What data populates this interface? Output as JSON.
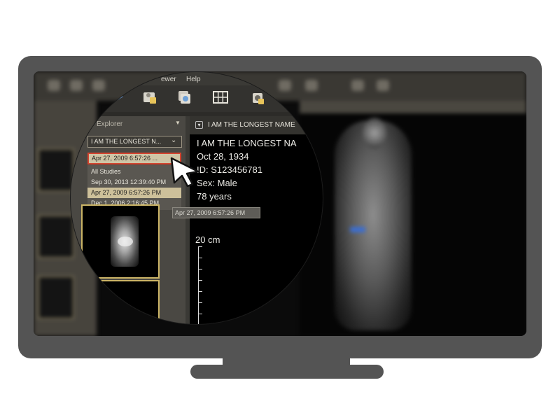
{
  "menu": {
    "viewer_partial": "ewer",
    "help": "Help"
  },
  "explorer": {
    "title_partial": "Explorer",
    "patient": "I AM THE LONGEST N...",
    "study_selected": "Apr 27, 2009 6:57:26 ...",
    "studies": [
      {
        "label": "All Studies"
      },
      {
        "label": "Sep 30, 2013 12:39:40 PM"
      },
      {
        "label": "Apr 27, 2009 6:57:26 PM"
      },
      {
        "label": "Dec 1, 2006 2:16:45 PM"
      }
    ]
  },
  "tooltip": "Apr 27, 2009 6:57:26 PM",
  "viewer": {
    "title": "I AM THE LONGEST NAME",
    "overlay": {
      "name": "I AM THE LONGEST NA",
      "dob": "Oct 28, 1934",
      "id": "ID: S123456781",
      "sex": "Sex: Male",
      "age": "78 years"
    },
    "scale": "20 cm"
  },
  "colors": {
    "monitor": "#545454",
    "highlight_border": "#d4442f",
    "thumbnail_border": "#cbb466"
  },
  "icons": [
    "patient-folder-icon",
    "multi-study-icon",
    "grid-layout-icon",
    "export-icon",
    "mouse-cursor-icon"
  ]
}
